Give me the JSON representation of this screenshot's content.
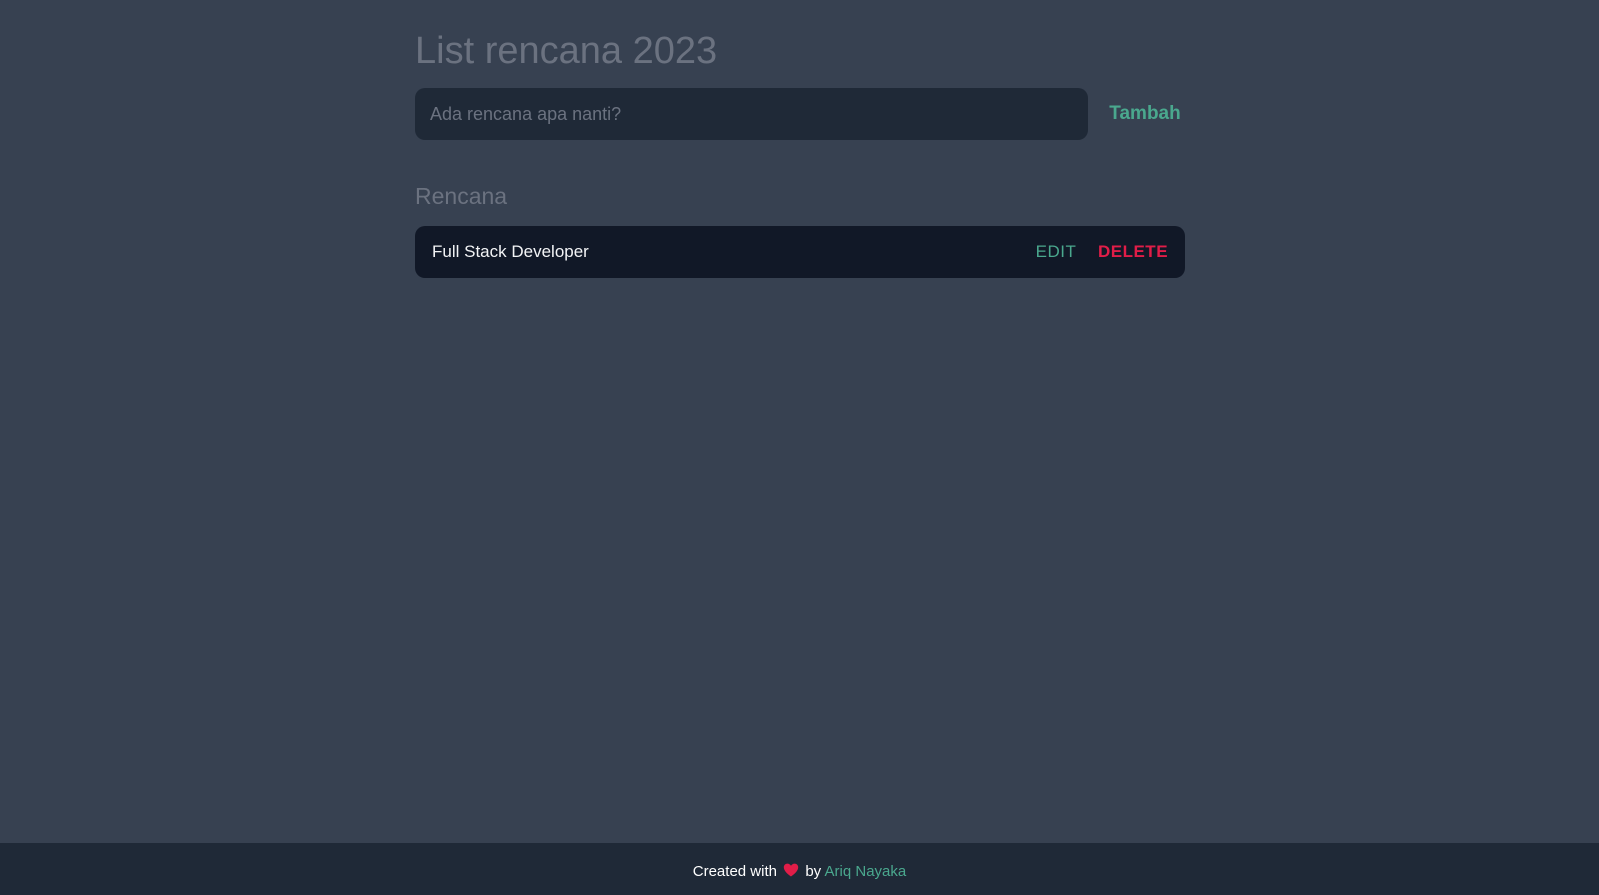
{
  "header": {
    "title": "List rencana 2023"
  },
  "add_form": {
    "placeholder": "Ada rencana apa nanti?",
    "value": "",
    "submit_label": "Tambah"
  },
  "plans": {
    "heading": "Rencana",
    "items": [
      {
        "text": "Full Stack Developer",
        "edit_label": "EDIT",
        "delete_label": "DELETE"
      }
    ]
  },
  "footer": {
    "prefix": "Created with",
    "icon": "heart-icon",
    "by": "by",
    "author": "Ariq Nayaka"
  },
  "colors": {
    "background": "#374151",
    "input_background": "#1f2937",
    "item_background": "#111827",
    "accent": "#4aa88e",
    "danger": "#e11d48",
    "muted_text": "#6b7280"
  }
}
